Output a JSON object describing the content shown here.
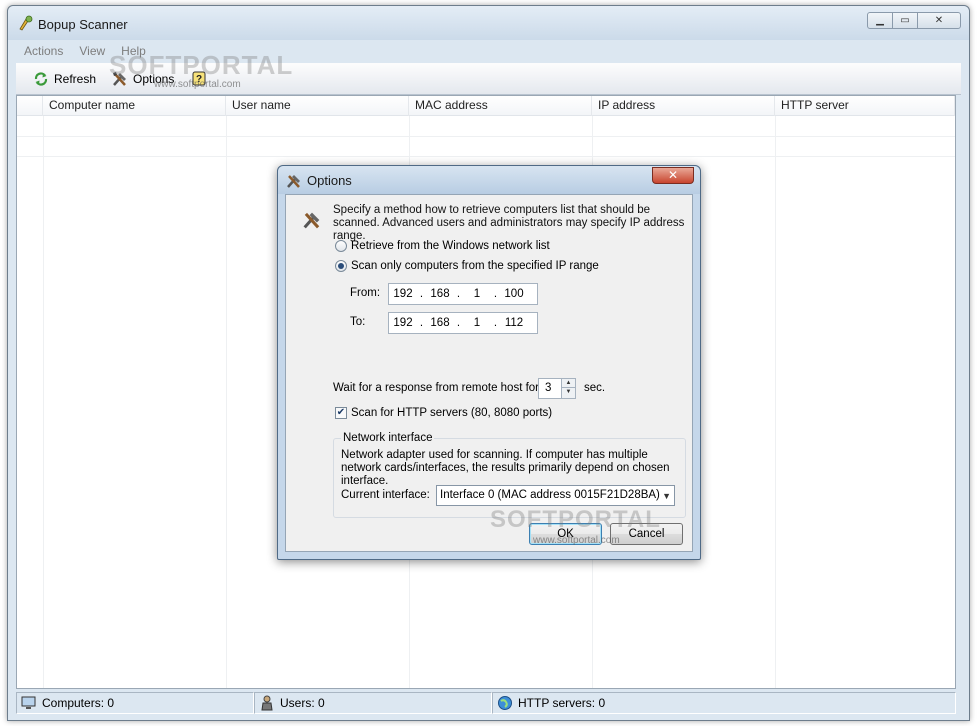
{
  "window": {
    "title": "Bopup Scanner",
    "min": "▁",
    "max": "▭",
    "close": "✕"
  },
  "menu": [
    "Actions",
    "View",
    "Help"
  ],
  "toolbar": {
    "refresh": "Refresh",
    "options": "Options"
  },
  "table": {
    "columns": [
      "Computer name",
      "User name",
      "MAC address",
      "IP address",
      "HTTP server"
    ]
  },
  "status": {
    "computers": "Computers: 0",
    "users": "Users: 0",
    "http": "HTTP servers: 0"
  },
  "watermark": {
    "brand": "SOFTPORTAL",
    "url": "www.softportal.com"
  },
  "dialog": {
    "title": "Options",
    "close": "✕",
    "description": "Specify a method how to retrieve computers list that should be scanned. Advanced users and administrators may specify IP address range.",
    "radio_windows": "Retrieve from the Windows network list",
    "radio_range": "Scan only computers from the specified IP range",
    "from_label": "From:",
    "to_label": "To:",
    "from_ip": [
      "192",
      "168",
      "1",
      "100"
    ],
    "to_ip": [
      "192",
      "168",
      "1",
      "112"
    ],
    "ip_sep": ".",
    "wait_label": "Wait for a response from remote host for",
    "wait_value": "3",
    "wait_unit": "sec.",
    "http_check": "Scan for HTTP servers (80, 8080 ports)",
    "http_checked": true,
    "group_title": "Network interface",
    "group_desc": "Network adapter used for scanning. If computer has multiple network cards/interfaces, the results primarily depend on chosen interface.",
    "iface_label": "Current interface:",
    "iface_value": "Interface 0 (MAC address 0015F21D28BA)",
    "ok": "OK",
    "cancel": "Cancel"
  }
}
